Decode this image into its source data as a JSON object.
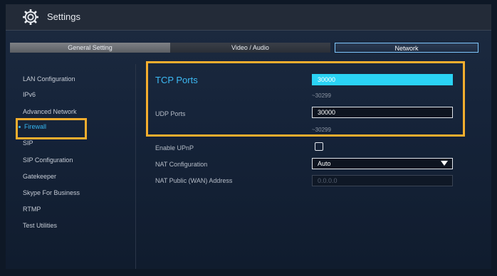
{
  "window": {
    "title": "Settings",
    "icon": "gear-icon"
  },
  "tabs": [
    {
      "label": "General Setting"
    },
    {
      "label": "Video / Audio"
    },
    {
      "label": "Network"
    }
  ],
  "sidebar": {
    "items": [
      {
        "label": "LAN Configuration"
      },
      {
        "label": "IPv6"
      },
      {
        "label": "Advanced Network"
      },
      {
        "label": "Firewall"
      },
      {
        "label": "SIP"
      },
      {
        "label": "SIP Configuration"
      },
      {
        "label": "Gatekeeper"
      },
      {
        "label": "Skype For Business"
      },
      {
        "label": "RTMP"
      },
      {
        "label": "Test Utilities"
      }
    ]
  },
  "firewall": {
    "tcp_label": "TCP Ports",
    "tcp_start": "30000",
    "tcp_end": "~30299",
    "udp_label": "UDP Ports",
    "udp_start": "30000",
    "udp_end": "~30299",
    "upnp_label": "Enable UPnP",
    "upnp_checked": false,
    "nat_label": "NAT Configuration",
    "nat_value": "Auto",
    "nat_public_label": "NAT Public (WAN) Address",
    "nat_public_placeholder": "0.0.0.0"
  },
  "colors": {
    "accent": "#35b6f0",
    "highlight": "#f5ae2e",
    "active_field": "#2ad3f5"
  }
}
